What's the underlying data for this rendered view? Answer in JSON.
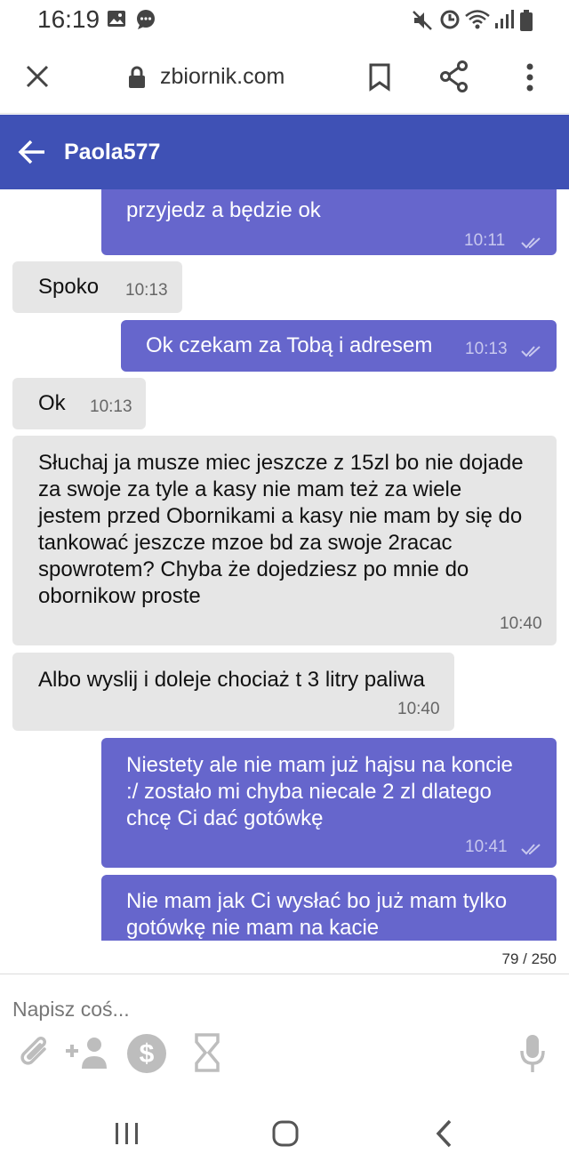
{
  "status_bar": {
    "time": "16:19",
    "left_icons": [
      "image-icon",
      "message-bubble-icon"
    ],
    "right_icons": [
      "mute-icon",
      "data-saver-icon",
      "wifi-icon",
      "signal-icon",
      "battery-icon"
    ]
  },
  "browser": {
    "url": "zbiornik.com",
    "icons": [
      "close-icon",
      "lock-icon",
      "bookmark-icon",
      "share-icon",
      "more-vert-icon"
    ]
  },
  "header": {
    "title": "Paola577",
    "back_icon": "arrow-back-icon",
    "color": "#3f51b5"
  },
  "colors": {
    "incoming_bubble": "#e6e6e6",
    "outgoing_bubble": "#6666cc"
  },
  "messages": [
    {
      "direction": "out",
      "text": "przyjedz a będzie ok",
      "time": "10:11",
      "read": true
    },
    {
      "direction": "in",
      "text": "Spoko",
      "time": "10:13"
    },
    {
      "direction": "out",
      "text": "Ok czekam za Tobą i adresem",
      "time": "10:13",
      "read": true
    },
    {
      "direction": "in",
      "text": "Ok",
      "time": "10:13"
    },
    {
      "direction": "in",
      "lines": [
        "Słuchaj ja musze miec jeszcze z 15zl bo nie dojade",
        "za swoje za tyle a kasy nie mam też za wiele",
        "jestem przed Obornikami a kasy nie mam by się do",
        "tankować jeszcze mzoe bd za swoje 2racac",
        "spowrotem? Chyba że dojedziesz po mnie do",
        "obornikow proste"
      ],
      "time": "10:40"
    },
    {
      "direction": "in",
      "text": "Albo wyslij i doleje chociaż t 3 litry paliwa",
      "time": "10:40"
    },
    {
      "direction": "out",
      "lines": [
        "Niestety ale nie mam już hajsu na koncie",
        ":/ zostało mi chyba niecale 2 zl dlatego",
        "chcę Ci dać gotówkę"
      ],
      "time": "10:41",
      "read": true
    },
    {
      "direction": "out",
      "lines": [
        "Nie mam jak Ci wysłać bo już mam tylko",
        "gotówkę nie mam na kacie"
      ]
    }
  ],
  "composer": {
    "counter": "79 / 250",
    "placeholder": "Napisz coś...",
    "tools": [
      "attach-icon",
      "add-person-icon",
      "dollar-icon",
      "hourglass-icon",
      "mic-icon"
    ]
  },
  "nav": {
    "icons": [
      "recent-apps-icon",
      "home-icon",
      "back-icon"
    ]
  }
}
